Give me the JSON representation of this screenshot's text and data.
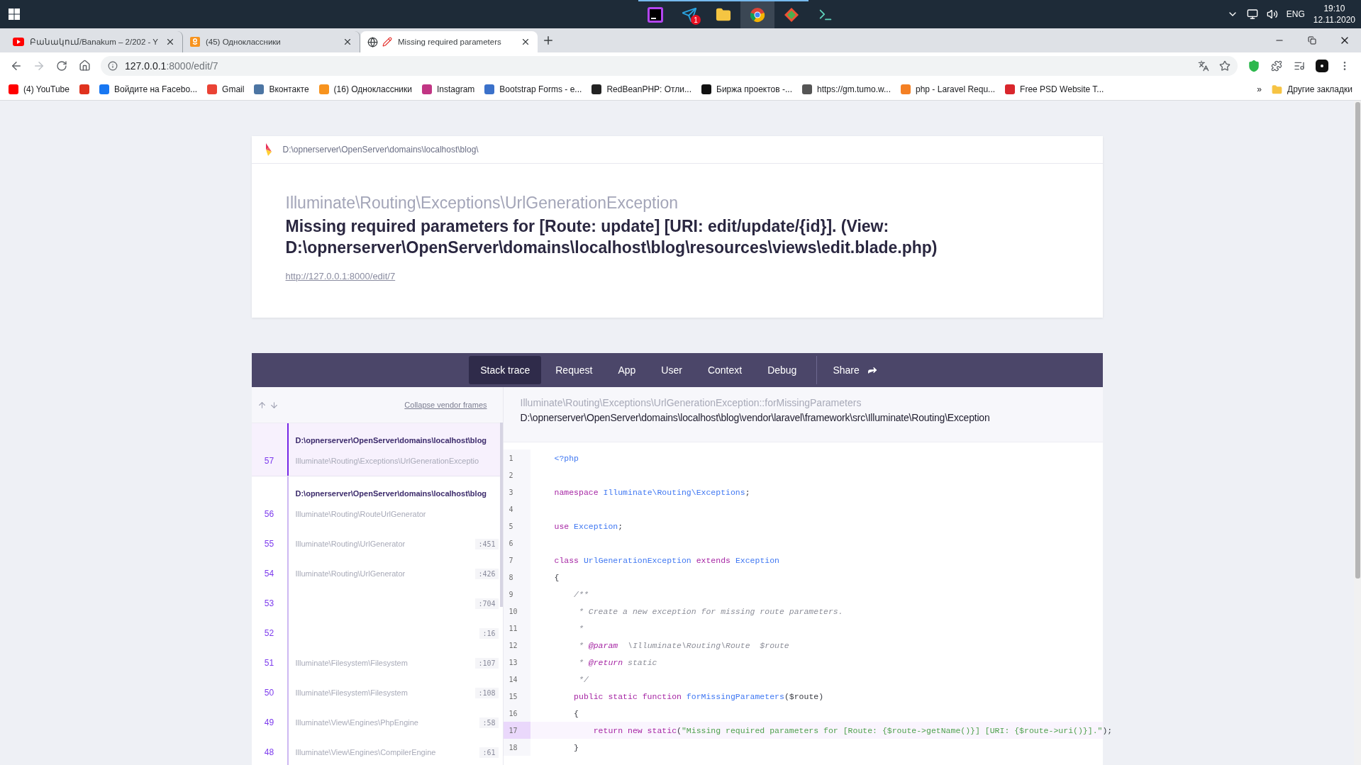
{
  "taskbar": {
    "apps": [
      {
        "kind": "phpstorm",
        "running": true,
        "selected": false
      },
      {
        "kind": "telegram",
        "running": true,
        "selected": false,
        "badge": "1"
      },
      {
        "kind": "explorer",
        "running": true,
        "selected": false
      },
      {
        "kind": "chrome",
        "running": true,
        "selected": true
      },
      {
        "kind": "git",
        "running": true,
        "selected": false
      },
      {
        "kind": "terminal",
        "running": false,
        "selected": false
      }
    ],
    "language": "ENG",
    "time": "19:10",
    "date": "12.11.2020"
  },
  "tabs": [
    {
      "kind": "youtube",
      "title": "Բանակում/Banakum – 2/202 - Y",
      "selected": false
    },
    {
      "kind": "ok",
      "title": "(45) Одноклассники",
      "selected": false
    },
    {
      "kind": "error",
      "title": "Missing required parameters",
      "selected": true
    }
  ],
  "address": {
    "host": "127.0.0.1",
    "path": ":8000/edit/7"
  },
  "bookmarks": [
    {
      "label": "(4) YouTube",
      "color": "#ff0000"
    },
    {
      "color": "#e0321e"
    },
    {
      "label": "Войдите на Facebo...",
      "color": "#1877f2"
    },
    {
      "label": "Gmail",
      "color": "#ea4335"
    },
    {
      "label": "Вконтакте",
      "color": "#4c75a3"
    },
    {
      "label": "(16) Одноклассники",
      "color": "#f7931e"
    },
    {
      "label": "Instagram",
      "color": "#c13584"
    },
    {
      "label": "Bootstrap Forms - e...",
      "color": "#3b71ca"
    },
    {
      "label": "RedBeanPHP: Отли...",
      "color": "#222222"
    },
    {
      "label": "Биржа проектов -...",
      "color": "#111111"
    },
    {
      "label": "https://gm.tumo.w...",
      "color": "#555555"
    },
    {
      "label": "php - Laravel Requ...",
      "color": "#f48024"
    },
    {
      "label": "Free PSD Website T...",
      "color": "#d9262c"
    }
  ],
  "bookmarks_more": "»",
  "other_bookmarks": "Другие закладки",
  "error": {
    "path": "D:\\opnerserver\\OpenServer\\domains\\localhost\\blog\\",
    "exception_class": "Illuminate\\Routing\\Exceptions\\UrlGenerationException",
    "message": "Missing required parameters for [Route: update] [URI: edit/update/{id}]. (View: D:\\opnerserver\\OpenServer\\domains\\localhost\\blog\\resources\\views\\edit.blade.php)",
    "url": "http://127.0.0.1:8000/edit/7"
  },
  "nav": [
    {
      "label": "Stack trace",
      "selected": true
    },
    {
      "label": "Request",
      "selected": false
    },
    {
      "label": "App",
      "selected": false
    },
    {
      "label": "User",
      "selected": false
    },
    {
      "label": "Context",
      "selected": false
    },
    {
      "label": "Debug",
      "selected": false
    }
  ],
  "share": "Share",
  "collapse_vendor": "Collapse vendor frames",
  "frames": [
    {
      "number": "57",
      "file": "D:\\opnerserver\\OpenServer\\domains\\localhost\\blog",
      "class": "Illuminate\\Routing\\Exceptions\\UrlGenerationExceptio",
      "selected": true
    },
    {
      "number": "56",
      "file": "D:\\opnerserver\\OpenServer\\domains\\localhost\\blog",
      "class": "Illuminate\\Routing\\RouteUrlGenerator",
      "selected": false
    },
    {
      "number": "55",
      "class": "Illuminate\\Routing\\UrlGenerator",
      "line": ":451",
      "selected": false
    },
    {
      "number": "54",
      "class": "Illuminate\\Routing\\UrlGenerator",
      "line": ":426",
      "selected": false
    },
    {
      "number": "53",
      "line": ":704",
      "selected": false
    },
    {
      "number": "52",
      "line": ":16",
      "selected": false
    },
    {
      "number": "51",
      "class": "Illuminate\\Filesystem\\Filesystem",
      "line": ":107",
      "selected": false
    },
    {
      "number": "50",
      "class": "Illuminate\\Filesystem\\Filesystem",
      "line": ":108",
      "selected": false
    },
    {
      "number": "49",
      "class": "Illuminate\\View\\Engines\\PhpEngine",
      "line": ":58",
      "selected": false
    },
    {
      "number": "48",
      "class": "Illuminate\\View\\Engines\\CompilerEngine",
      "line": ":61",
      "selected": false
    }
  ],
  "code": {
    "method": "Illuminate\\Routing\\Exceptions\\UrlGenerationException::forMissingParameters",
    "file": "D:\\opnerserver\\OpenServer\\domains\\localhost\\blog\\vendor\\laravel\\framework\\src\\Illuminate\\Routing\\Exception",
    "lines": [
      {
        "number": "1",
        "selected": false,
        "tokens": [
          {
            "kind": "name",
            "text": "<?php"
          }
        ]
      },
      {
        "number": "2",
        "selected": false
      },
      {
        "number": "3",
        "selected": false,
        "tokens": [
          {
            "kind": "keyword",
            "text": "namespace "
          },
          {
            "kind": "name",
            "text": "Illuminate\\Routing\\Exceptions"
          },
          {
            "kind": "plain",
            "text": ";"
          }
        ]
      },
      {
        "number": "4",
        "selected": false
      },
      {
        "number": "5",
        "selected": false,
        "tokens": [
          {
            "kind": "keyword",
            "text": "use "
          },
          {
            "kind": "name",
            "text": "Exception"
          },
          {
            "kind": "plain",
            "text": ";"
          }
        ]
      },
      {
        "number": "6",
        "selected": false
      },
      {
        "number": "7",
        "selected": false,
        "tokens": [
          {
            "kind": "keyword",
            "text": "class "
          },
          {
            "kind": "name",
            "text": "UrlGenerationException "
          },
          {
            "kind": "keyword",
            "text": "extends "
          },
          {
            "kind": "name",
            "text": "Exception"
          }
        ]
      },
      {
        "number": "8",
        "selected": false,
        "tokens": [
          {
            "kind": "plain",
            "text": "{"
          }
        ]
      },
      {
        "number": "9",
        "selected": false,
        "tokens": [
          {
            "kind": "comment",
            "text": "    /**"
          }
        ]
      },
      {
        "number": "10",
        "selected": false,
        "tokens": [
          {
            "kind": "comment",
            "text": "     * Create a new exception for missing route parameters."
          }
        ]
      },
      {
        "number": "11",
        "selected": false,
        "tokens": [
          {
            "kind": "comment",
            "text": "     *"
          }
        ]
      },
      {
        "number": "12",
        "selected": false,
        "tokens": [
          {
            "kind": "comment",
            "text": "     * "
          },
          {
            "kind": "doctag",
            "text": "@param"
          },
          {
            "kind": "comment",
            "text": "  \\Illuminate\\Routing\\Route  $route"
          }
        ]
      },
      {
        "number": "13",
        "selected": false,
        "tokens": [
          {
            "kind": "comment",
            "text": "     * "
          },
          {
            "kind": "doctag",
            "text": "@return"
          },
          {
            "kind": "comment",
            "text": " static"
          }
        ]
      },
      {
        "number": "14",
        "selected": false,
        "tokens": [
          {
            "kind": "comment",
            "text": "     */"
          }
        ]
      },
      {
        "number": "15",
        "selected": false,
        "tokens": [
          {
            "kind": "keyword",
            "text": "    public static function "
          },
          {
            "kind": "name",
            "text": "forMissingParameters"
          },
          {
            "kind": "plain",
            "text": "($route)"
          }
        ]
      },
      {
        "number": "16",
        "selected": false,
        "tokens": [
          {
            "kind": "plain",
            "text": "    {"
          }
        ]
      },
      {
        "number": "17",
        "selected": true,
        "tokens": [
          {
            "kind": "keyword",
            "text": "        return new static"
          },
          {
            "kind": "plain",
            "text": "("
          },
          {
            "kind": "string",
            "text": "\"Missing required parameters for [Route: {$route->getName()}] [URI: {$route->uri()}].\""
          },
          {
            "kind": "plain",
            "text": ");"
          }
        ]
      },
      {
        "number": "18",
        "selected": false,
        "tokens": [
          {
            "kind": "plain",
            "text": "    }"
          }
        ]
      }
    ]
  }
}
